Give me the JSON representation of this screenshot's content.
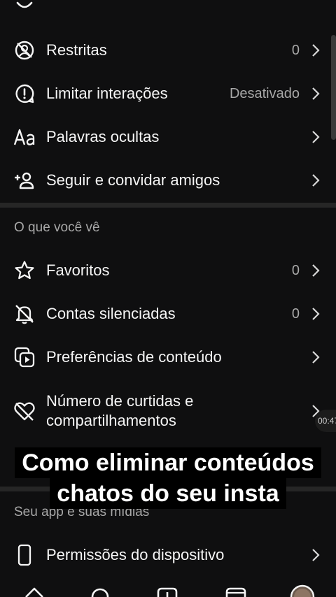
{
  "settings": {
    "items_top": [
      {
        "label": "Restritas",
        "value": "0",
        "icon": "restrict-icon"
      },
      {
        "label": "Limitar interações",
        "value": "Desativado",
        "icon": "limit-interactions-icon"
      },
      {
        "label": "Palavras ocultas",
        "value": "",
        "icon": "text-aa-icon"
      },
      {
        "label": "Seguir e convidar amigos",
        "value": "",
        "icon": "add-person-icon"
      }
    ],
    "section_what_you_see": "O que você vê",
    "items_see": [
      {
        "label": "Favoritos",
        "value": "0",
        "icon": "star-icon"
      },
      {
        "label": "Contas silenciadas",
        "value": "0",
        "icon": "muted-bell-icon"
      },
      {
        "label": "Preferências de conteúdo",
        "value": "",
        "icon": "content-preferences-icon"
      },
      {
        "label_line1": "Número de curtidas e",
        "label_line2": "compartilhamentos",
        "icon": "hidden-heart-icon"
      }
    ],
    "section_app_media": "Seu app e suas mídias",
    "item_permissions": {
      "label": "Permissões do dispositivo",
      "icon": "phone-icon"
    }
  },
  "overlay": {
    "timer": "00:47",
    "caption_line1": "Como eliminar conteúdos",
    "caption_line2": "chatos do seu insta"
  }
}
